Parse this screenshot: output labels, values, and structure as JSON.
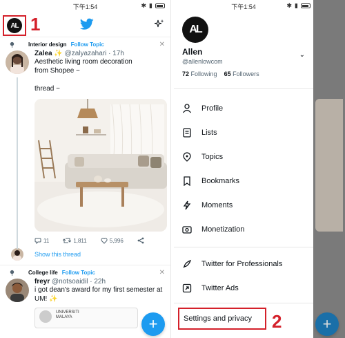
{
  "status": {
    "time": "下午1:54"
  },
  "left": {
    "annotation_number": "1",
    "tweet1": {
      "topic": "Interior design",
      "follow_label": "Follow Topic",
      "name": "Zalea",
      "handle": "@zalyazahari · 17h",
      "text_line1": "Aesthetic living room decoration",
      "text_line2": "from Shopee ~",
      "text_line3": "thread ~",
      "replies": "11",
      "retweets": "1,811",
      "likes": "5,996",
      "show_thread": "Show this thread"
    },
    "tweet2": {
      "topic": "College life",
      "follow_label": "Follow Topic",
      "name": "freyr",
      "handle": "@notsoaidil · 22h",
      "text_line1": "i got dean's award for my first semester at",
      "text_line2": "UM! ✨",
      "doc_line1": "UNIVERSITI",
      "doc_line2": "MALAYA"
    },
    "fab": "+"
  },
  "drawer": {
    "avatar_text": "AL",
    "name": "Allen",
    "handle": "@allenlowcom",
    "following_count": "72",
    "following_label": "Following",
    "followers_count": "65",
    "followers_label": "Followers",
    "items": [
      {
        "label": "Profile",
        "icon": "person-icon"
      },
      {
        "label": "Lists",
        "icon": "list-icon"
      },
      {
        "label": "Topics",
        "icon": "topics-icon"
      },
      {
        "label": "Bookmarks",
        "icon": "bookmark-icon"
      },
      {
        "label": "Moments",
        "icon": "moments-icon"
      },
      {
        "label": "Monetization",
        "icon": "monetization-icon"
      }
    ],
    "pro_items": [
      {
        "label": "Twitter for Professionals",
        "icon": "rocket-icon"
      },
      {
        "label": "Twitter Ads",
        "icon": "ads-icon"
      }
    ],
    "settings_label": "Settings and privacy",
    "annotation_number": "2"
  },
  "colors": {
    "accent": "#1d9bf0",
    "annotation": "#d4202a"
  }
}
